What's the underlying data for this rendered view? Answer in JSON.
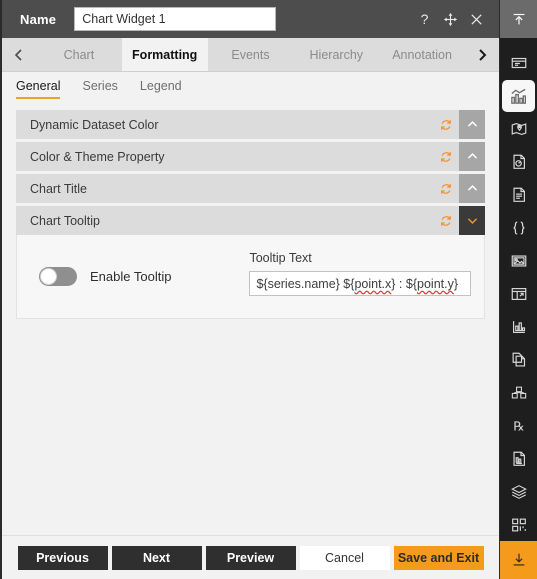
{
  "titlebar": {
    "name_label": "Name",
    "name_value": "Chart Widget 1",
    "name_placeholder": "Chart Widget 1",
    "help_icon": "question-mark-icon",
    "move_icon": "move-cross-icon",
    "close_icon": "close-x-icon"
  },
  "tabstrip": {
    "prev_arrow": "chevron-left-icon",
    "next_arrow": "chevron-right-icon",
    "tabs": [
      {
        "label": "Chart",
        "active": false
      },
      {
        "label": "Formatting",
        "active": true
      },
      {
        "label": "Events",
        "active": false
      },
      {
        "label": "Hierarchy",
        "active": false
      },
      {
        "label": "Annotation",
        "active": false
      }
    ]
  },
  "subtabs": [
    {
      "label": "General",
      "active": true
    },
    {
      "label": "Series",
      "active": false
    },
    {
      "label": "Legend",
      "active": false
    }
  ],
  "accordions": [
    {
      "title": "Dynamic Dataset Color",
      "expanded": false,
      "reset_icon": "refresh-reset-icon",
      "chevron_icon": "chevron-up-icon"
    },
    {
      "title": "Color & Theme Property",
      "expanded": false,
      "reset_icon": "refresh-reset-icon",
      "chevron_icon": "chevron-up-icon"
    },
    {
      "title": "Chart Title",
      "expanded": false,
      "reset_icon": "refresh-reset-icon",
      "chevron_icon": "chevron-up-icon"
    },
    {
      "title": "Chart Tooltip",
      "expanded": true,
      "reset_icon": "refresh-reset-icon",
      "chevron_icon": "chevron-down-icon"
    }
  ],
  "tooltip_section": {
    "toggle_label": "Enable Tooltip",
    "toggle_state": "off",
    "field_label": "Tooltip Text",
    "field_value_part1": "${series.name} ${",
    "field_value_spell1": "point.x",
    "field_value_part2": "} : ${",
    "field_value_spell2": "point.y",
    "field_value_part3": "}",
    "field_value_full": "${series.name} ${point.x} : ${point.y}"
  },
  "footer": {
    "previous": "Previous",
    "next": "Next",
    "preview": "Preview",
    "cancel": "Cancel",
    "save_and_exit": "Save and Exit"
  },
  "rail": {
    "top_icon": "collapse-up-icon",
    "bottom_icon": "download-icon",
    "items": [
      {
        "icon": "widget-panel-icon",
        "active": false
      },
      {
        "icon": "chart-bars-icon",
        "active": true
      },
      {
        "icon": "map-pin-icon",
        "active": false
      },
      {
        "icon": "document-gauge-icon",
        "active": false
      },
      {
        "icon": "document-lines-icon",
        "active": false
      },
      {
        "icon": "code-braces-icon",
        "active": false
      },
      {
        "icon": "image-icon",
        "active": false
      },
      {
        "icon": "table-grid-icon",
        "active": false
      },
      {
        "icon": "bar-graph-icon",
        "active": false
      },
      {
        "icon": "copy-pages-icon",
        "active": false
      },
      {
        "icon": "cubes-stack-icon",
        "active": false
      },
      {
        "icon": "prescription-rx-icon",
        "active": false
      },
      {
        "icon": "report-document-icon",
        "active": false
      },
      {
        "icon": "layers-stack-icon",
        "active": false
      },
      {
        "icon": "qr-blocks-icon",
        "active": false
      }
    ]
  },
  "colors": {
    "accent": "#f59b1c",
    "titlebar_bg": "#4d4d4d",
    "rail_bg": "#1e1e1e",
    "accordion_bg": "#dcdcdc",
    "page_bg": "#f2f2f2",
    "spellcheck_underline": "#e23b3b"
  }
}
